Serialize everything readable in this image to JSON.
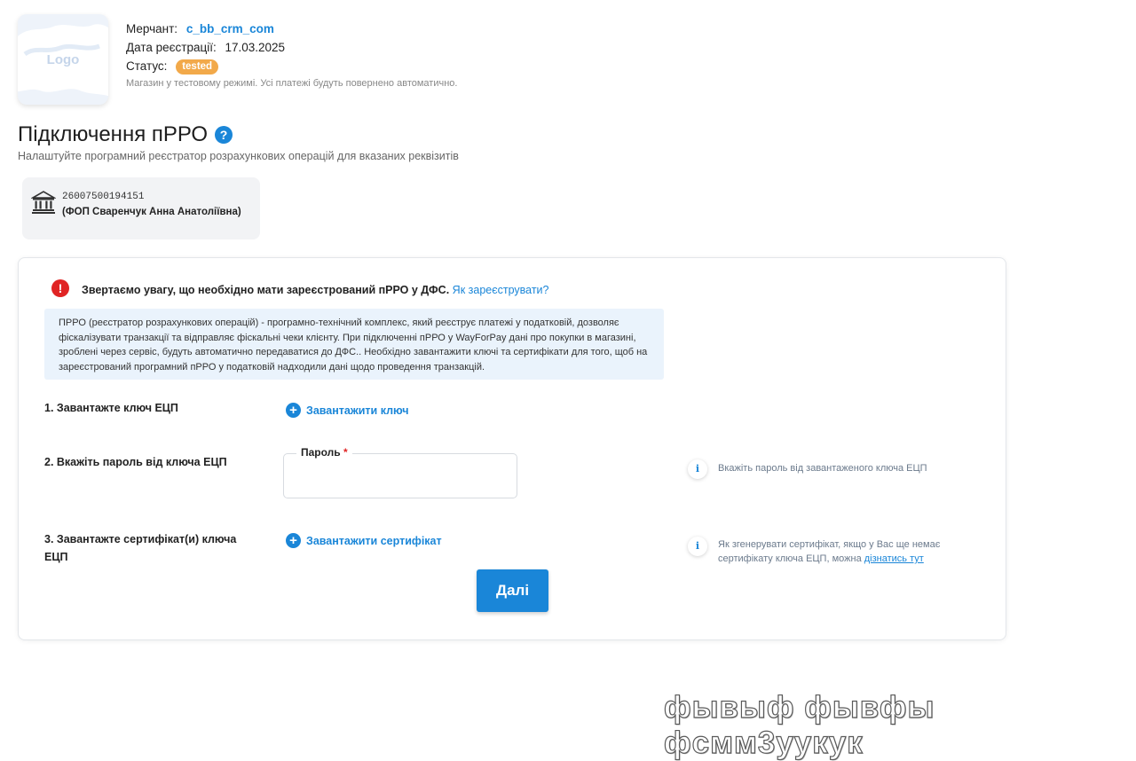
{
  "merchant": {
    "logo_text": "Logo",
    "merchant_label": "Мерчант:",
    "merchant_value": "c_bb_crm_com",
    "reg_label": "Дата реєстрації:",
    "reg_value": "17.03.2025",
    "status_label": "Статус:",
    "status_value": "tested",
    "test_note": "Магазин у тестовому режимі. Усі платежі будуть повернено автоматично."
  },
  "page": {
    "title": "Підключення пРРО",
    "help_glyph": "?",
    "subtitle": "Налаштуйте програмний реєстратор розрахункових операцій для вказаних реквізитів"
  },
  "bank": {
    "account": "26007500194151",
    "name": "(ФОП Сваренчук Анна Анатоліївна)"
  },
  "alert": {
    "glyph": "!",
    "text": "Звертаємо увагу, що необхідно мати зареєстрований пРРО у ДФС.",
    "link": "Як зареєструвати?"
  },
  "info": {
    "text": "ПРРО (реєстратор розрахункових операцій) - програмно-технічний комплекс, який реєструє платежі у податковій, дозволяє фіскалізувати транзакції та відправляє фіскальні чеки клієнту. При підключенні пРРО у WayForPay дані про покупки в магазині, зроблені через сервіс, будуть автоматично передаватися до ДФС.. Необхідно завантажити ключі та сертифікати для того, щоб на зареєстрований програмний пРРО у податковій надходили дані щодо проведення транзакцій."
  },
  "steps": {
    "step1_label": "1. Завантажте ключ ЕЦП",
    "step1_action": "Завантажити ключ",
    "step2_label": "2. Вкажіть пароль від ключа ЕЦП",
    "password_label": "Пароль",
    "required_mark": "*",
    "password_value": "",
    "step2_hint": "Вкажіть пароль від завантаженого ключа ЕЦП",
    "step3_label": "3. Завантажте сертифікат(и) ключа ЕЦП",
    "step3_action": "Завантажити сертифікат",
    "step3_hint": "Як згенерувати сертифікат, якщо у Вас ще немає сертифікату ключа ЕЦП, можна",
    "step3_hint_link": "дізнатись тут",
    "plus_glyph": "+",
    "info_glyph": "i"
  },
  "next_button": "Далі",
  "watermark": "фывыф фывфы фсмм3уукук",
  "colors": {
    "accent": "#1a86d8",
    "status_badge": "#f2a94a",
    "alert": "#e02424",
    "info_bg": "#eaf3fc"
  }
}
